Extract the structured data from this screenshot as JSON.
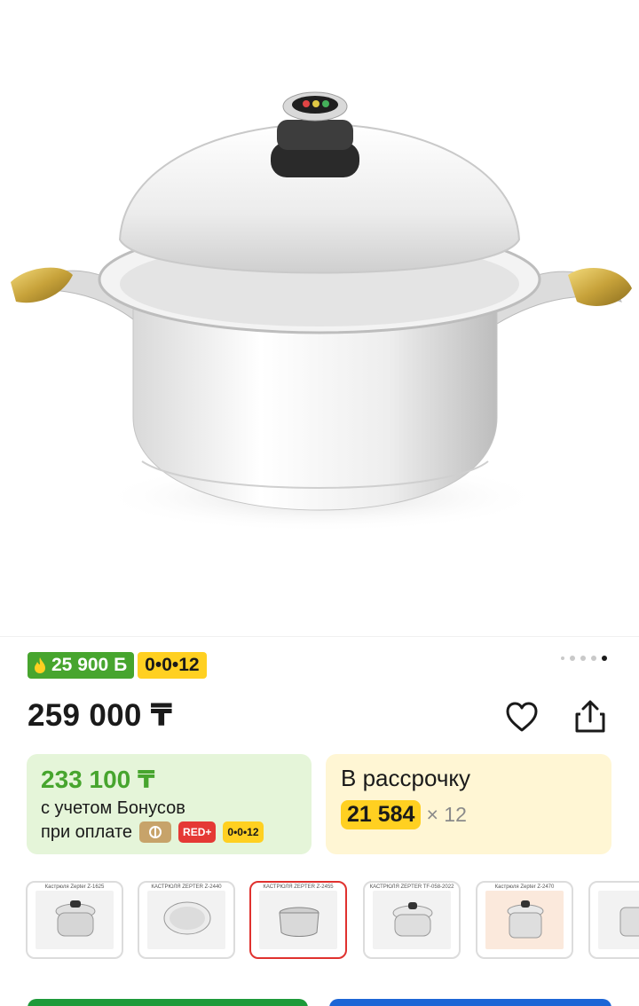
{
  "gallery": {
    "image_alt": "pot-with-lid-photo",
    "slide_count": 5,
    "active_slide": 5
  },
  "badges": {
    "bonus_amount": "25 900 Б",
    "installment_plan": "0•0•12"
  },
  "price": {
    "current": "259 000 ₸"
  },
  "bonus_card": {
    "price": "233 100 ₸",
    "note": "с учетом Бонусов",
    "pay_label": "при оплате",
    "methods": {
      "red": "RED+",
      "plan": "0•0•12"
    }
  },
  "installment_card": {
    "title": "В рассрочку",
    "amount": "21 584",
    "multiplier": "× 12"
  },
  "thumbnails": [
    {
      "caption": "Кастрюля Zepter Z-1625"
    },
    {
      "caption": "КАСТРЮЛЯ ZEPTER Z-2440"
    },
    {
      "caption": "КАСТРЮЛЯ ZEPTER Z-2455"
    },
    {
      "caption": "КАСТРЮЛЯ ZEPTER TF-058-2022"
    },
    {
      "caption": "Кастрюля Zepter Z-2470"
    },
    {
      "caption": ""
    }
  ],
  "colors": {
    "accent_green": "#47a52e",
    "plan_yellow": "#ffd021",
    "selected_border": "#e0322f"
  },
  "icons": {
    "favorite": "heart-icon",
    "share": "share-icon",
    "bonus": "flame-icon"
  }
}
